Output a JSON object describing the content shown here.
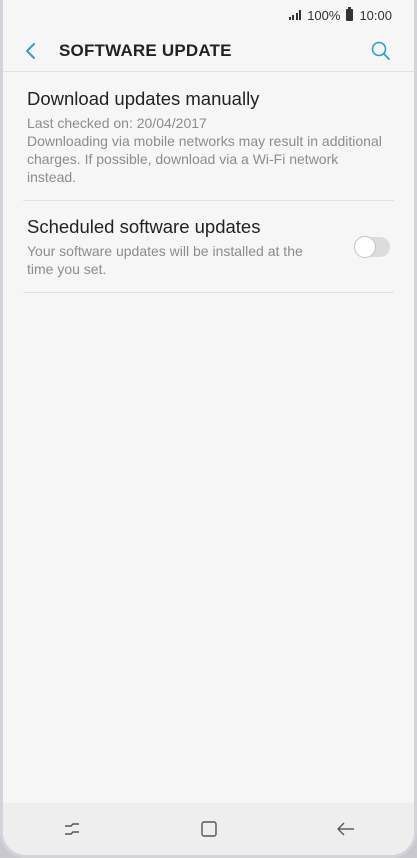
{
  "status": {
    "battery": "100%",
    "time": "10:00"
  },
  "appbar": {
    "title": "SOFTWARE UPDATE"
  },
  "items": [
    {
      "title": "Download updates manually",
      "subtitle": "Last checked on: 20/04/2017\nDownloading via mobile networks may result in additional charges. If possible, download via a Wi-Fi network instead."
    },
    {
      "title": "Scheduled software updates",
      "subtitle": "Your software updates will be installed at the time you set.",
      "toggle_on": false
    }
  ],
  "icons": {
    "back": "back-arrow-icon",
    "search": "search-icon",
    "recent": "recent-apps-icon",
    "home": "home-icon",
    "nav_back": "nav-back-icon"
  },
  "colors": {
    "accent": "#2aa3c6",
    "background": "#f7f6f6"
  }
}
